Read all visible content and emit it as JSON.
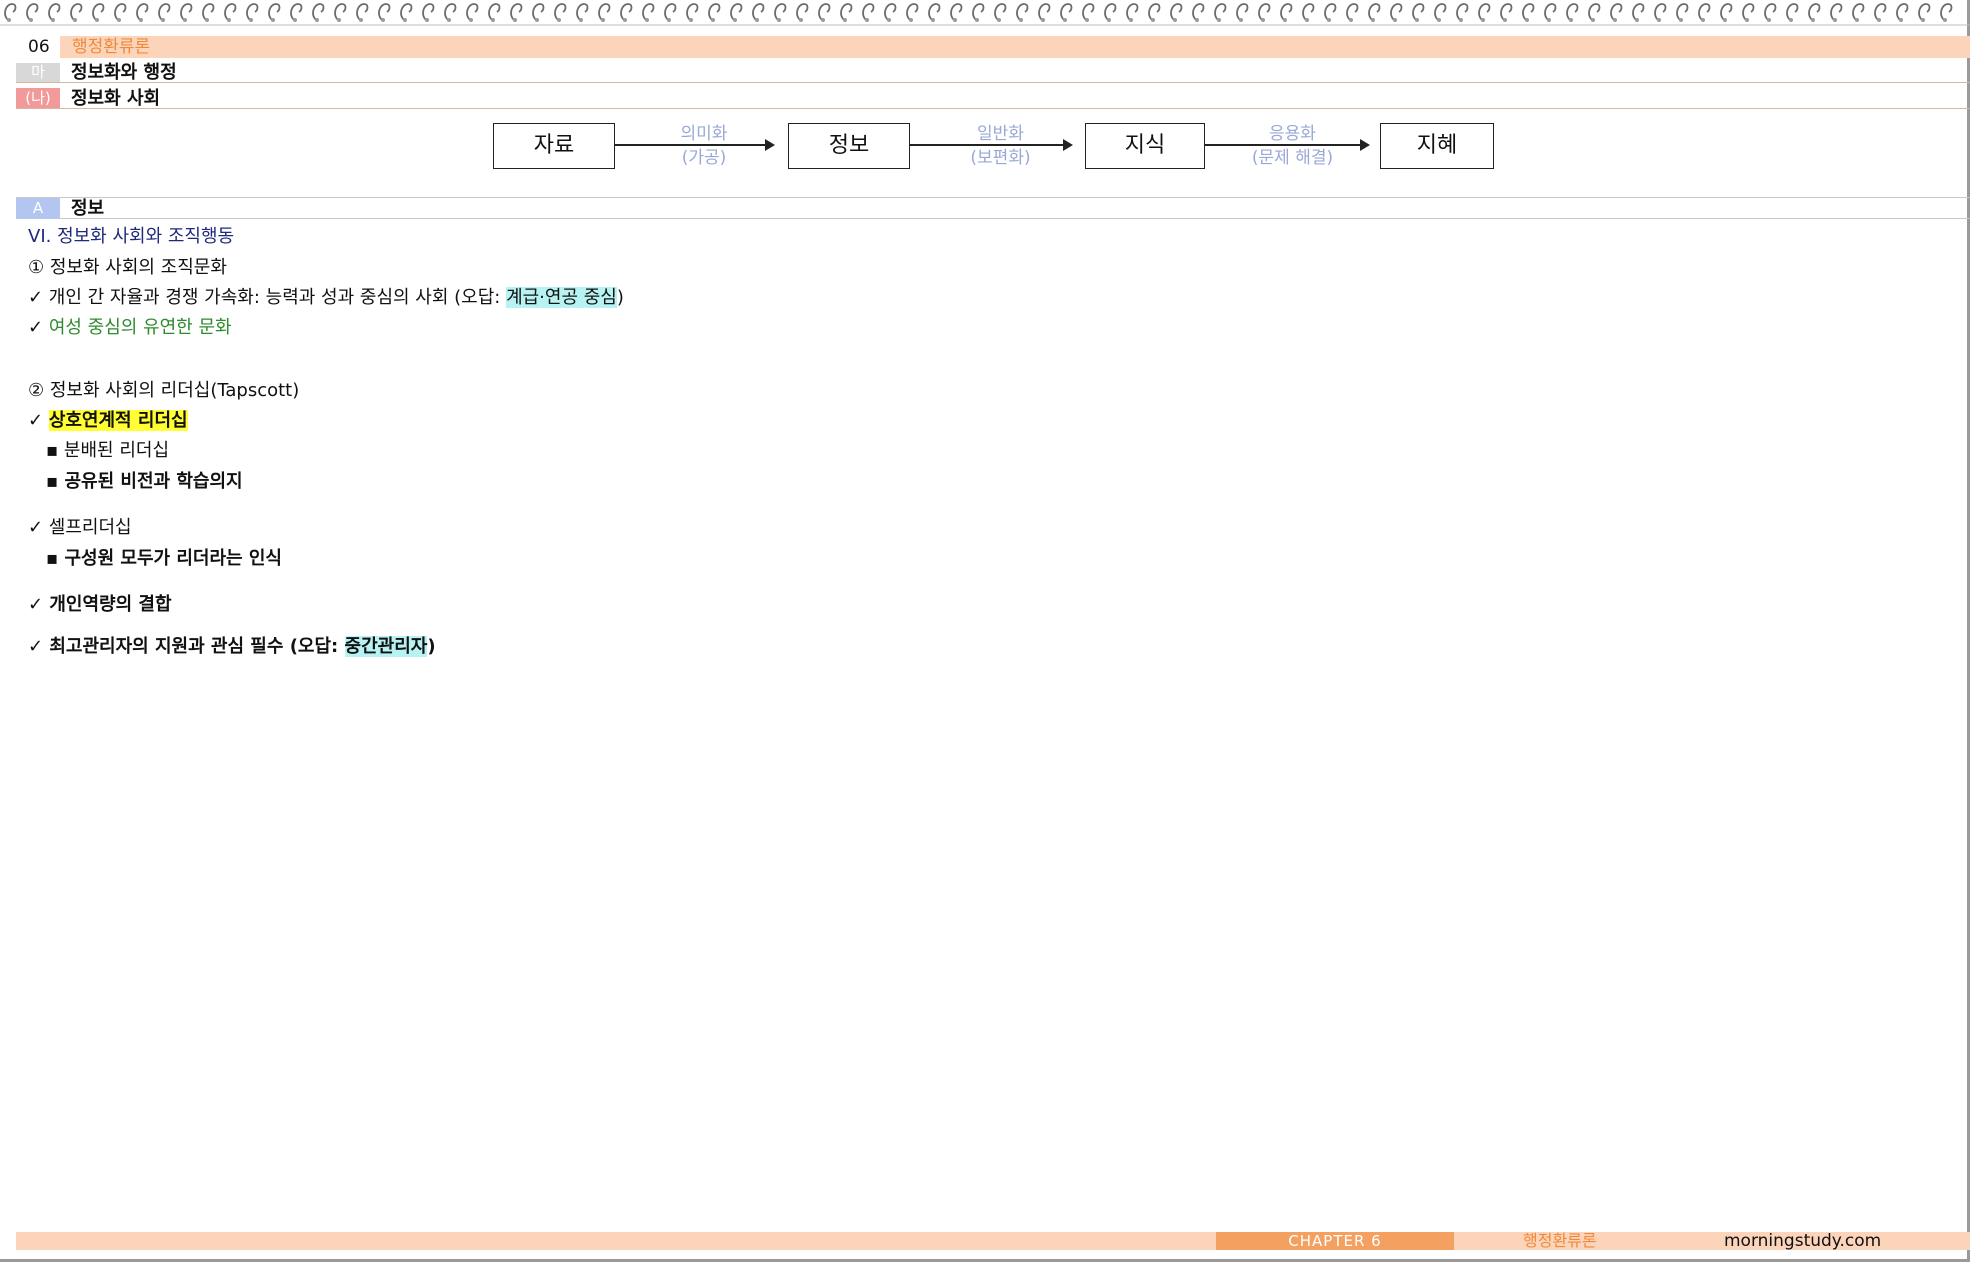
{
  "header": {
    "chapter_num": "06",
    "chapter_title": "행정환류론",
    "section_tag": "마",
    "section_title": "정보화와 행정",
    "subsection_tag": "(나)",
    "subsection_title": "정보화 사회"
  },
  "flow": {
    "boxes": [
      "자료",
      "정보",
      "지식",
      "지혜"
    ],
    "arrows": [
      {
        "top": "의미화",
        "bottom": "(가공)"
      },
      {
        "top": "일반화",
        "bottom": "(보편화)"
      },
      {
        "top": "응용화",
        "bottom": "(문제 해결)"
      }
    ]
  },
  "topic": {
    "tag": "A",
    "title": "정보"
  },
  "content": {
    "heading": "VI. 정보화 사회와 조직행동",
    "item1": "① 정보화 사회의 조직문화",
    "check1_prefix": "✓ 개인 간 자율과 경쟁 가속화: 능력과 성과 중심의 사회 (오답: ",
    "check1_highlight": "계급·연공 중심",
    "check1_suffix": ")",
    "check2_mark": "✓ ",
    "check2_text": "여성 중심의 유연한 문화",
    "item2": "② 정보화 사회의 리더십(Tapscott)",
    "check3_mark": "✓ ",
    "check3_highlight": "상호연계적 리더십",
    "bullet1": "▪ 분배된 리더십",
    "bullet2": "▪ 공유된 비전과 학습의지",
    "check4": "✓ 셀프리더십",
    "bullet3": "▪ 구성원 모두가 리더라는 인식",
    "check5": "✓ 개인역량의 결합",
    "check6_prefix": "✓ 최고관리자의 지원과 관심 필수 (오답: ",
    "check6_highlight": "중간관리자",
    "check6_suffix": ")"
  },
  "footer": {
    "chapter": "CHAPTER  6",
    "title": "행정환류론",
    "site": "morningstudy.com"
  },
  "colors": {
    "header_band": "#fbd4b9",
    "accent_orange": "#f08a3a",
    "cyan_highlight": "#b8f3f3",
    "yellow_highlight": "#ffff33",
    "flow_label": "#9aa8d6"
  }
}
